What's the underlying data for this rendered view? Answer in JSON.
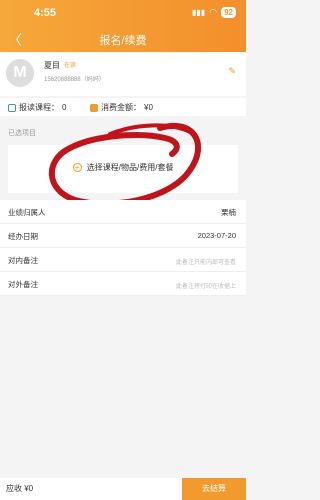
{
  "status": {
    "time": "4:55",
    "battery": "92"
  },
  "nav": {
    "back": "〈",
    "title": "报名/续费"
  },
  "user": {
    "avatar_letter": "M",
    "name": "夏目",
    "status": "在读",
    "phone": "15620888888（妈妈）",
    "edit_icon": "edit-icon"
  },
  "stats": {
    "reading_label": "报读课程：",
    "reading_value": "0",
    "spend_label": "消费金额：",
    "spend_value": "¥0"
  },
  "selected": {
    "label": "已选项目",
    "choose_text": "选择课程/物品/费用/套餐"
  },
  "form": [
    {
      "label": "业绩归属人",
      "value": "栗楠",
      "placeholder": false
    },
    {
      "label": "经办日期",
      "value": "2023-07-20",
      "placeholder": false
    },
    {
      "label": "对内备注",
      "value": "此备注只能内部可查看",
      "placeholder": true
    },
    {
      "label": "对外备注",
      "value": "此备注将打印在收据上",
      "placeholder": true
    }
  ],
  "bottom": {
    "due": "应收 ¥0",
    "pay": "去结算"
  },
  "colors": {
    "accent": "#f39a2f",
    "annotation": "#c0141b"
  }
}
